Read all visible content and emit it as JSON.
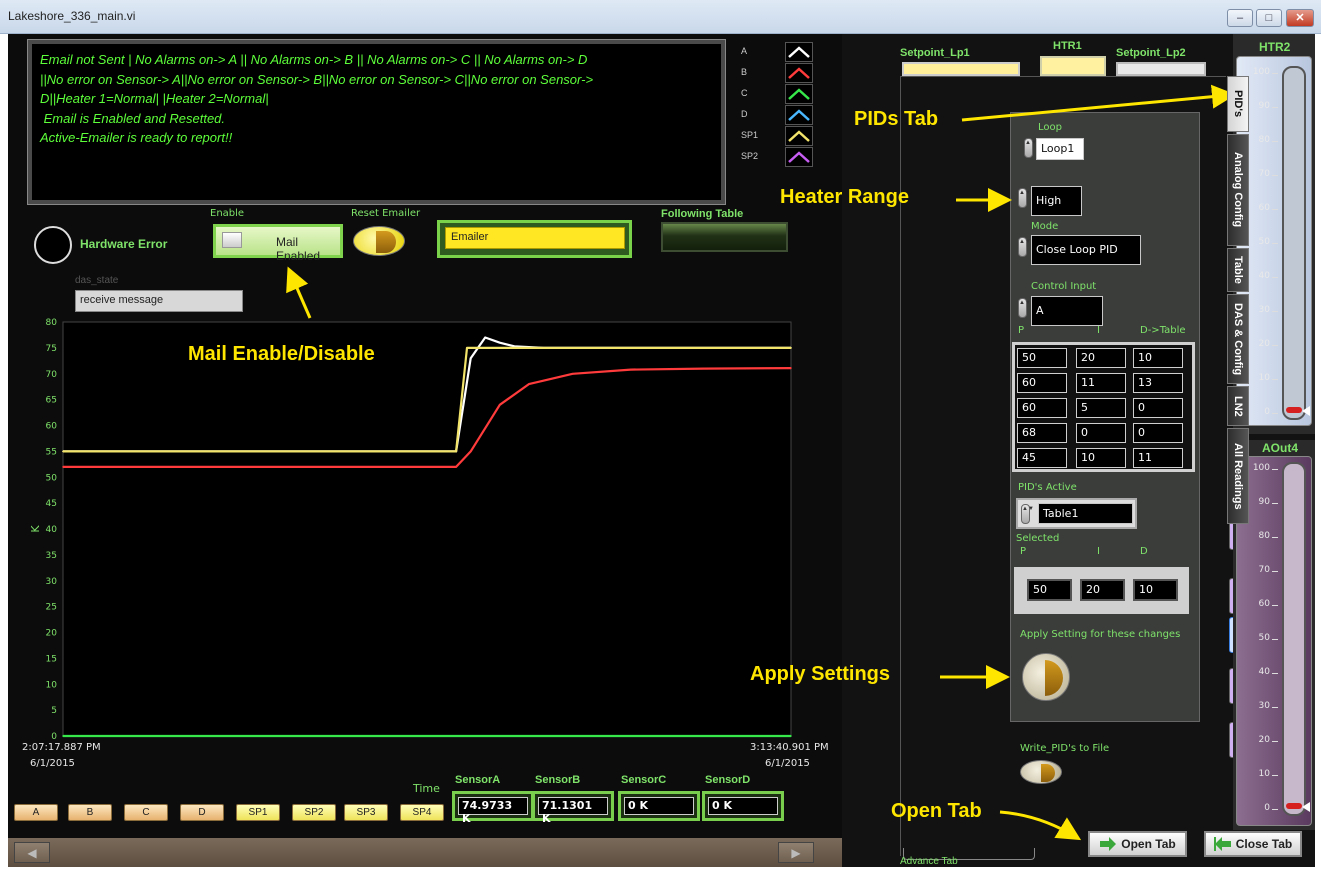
{
  "window": {
    "title": "Lakeshore_336_main.vi",
    "min": "–",
    "max": "□",
    "close": "✕"
  },
  "status_message": "Email not Sent | No Alarms on-> A || No Alarms on-> B || No Alarms on-> C || No Alarms on-> D\n||No error on Sensor-> A||No error on Sensor-> B||No error on Sensor-> C||No error on Sensor->\nD||Heater 1=Normal| |Heater 2=Normal|\n Email is Enabled and Resetted.\nActive-Emailer is ready to report!!",
  "legend": [
    {
      "label": "A",
      "color": "#ffffff"
    },
    {
      "label": "B",
      "color": "#ff3b3b"
    },
    {
      "label": "C",
      "color": "#37e84a"
    },
    {
      "label": "D",
      "color": "#4ab8ff"
    },
    {
      "label": "SP1",
      "color": "#f2e36a"
    },
    {
      "label": "SP2",
      "color": "#c75df2"
    }
  ],
  "controls": {
    "hardware_error": "Hardware Error",
    "enable_label": "Enable",
    "mail_button": "Mail Enabled",
    "reset_label": "Reset Emailer",
    "emailer_value": "Emailer",
    "following_table": "Following Table",
    "das_state_label": "das_state",
    "das_state_value": "receive message"
  },
  "annotations": {
    "mail": "Mail Enable/Disable",
    "pids_tab": "PIDs Tab",
    "heater_range": "Heater Range",
    "apply": "Apply Settings",
    "open_tab": "Open Tab"
  },
  "chart_data": {
    "type": "line",
    "ylabel": "K",
    "ylim": [
      0,
      80
    ],
    "yticks": [
      0,
      5,
      10,
      15,
      20,
      25,
      30,
      35,
      40,
      45,
      50,
      55,
      60,
      65,
      70,
      75,
      80
    ],
    "x_start_label": "2:07:17.887 PM",
    "x_start_date": "6/1/2015",
    "x_end_label": "3:13:40.901 PM",
    "x_end_date": "6/1/2015",
    "x_axis_title": "Time",
    "series": [
      {
        "name": "A",
        "color": "#ffffff",
        "x": [
          0,
          0.54,
          0.56,
          0.58,
          0.6,
          0.62,
          0.66,
          0.72,
          1
        ],
        "y": [
          55,
          55,
          73,
          77,
          76,
          75.3,
          75,
          75,
          75
        ]
      },
      {
        "name": "B",
        "color": "#ff3b3b",
        "x": [
          0,
          0.54,
          0.56,
          0.6,
          0.64,
          0.7,
          0.78,
          0.88,
          1
        ],
        "y": [
          52,
          52,
          55,
          64,
          68,
          70,
          70.8,
          71,
          71.1
        ]
      },
      {
        "name": "SP1",
        "color": "#f2e36a",
        "x": [
          0,
          0.54,
          0.555,
          1
        ],
        "y": [
          55,
          55,
          75,
          75
        ]
      },
      {
        "name": "C",
        "color": "#37e84a",
        "x": [
          0,
          1
        ],
        "y": [
          0,
          0
        ]
      }
    ]
  },
  "sensors": [
    {
      "title": "SensorA",
      "value": "74.9733 K"
    },
    {
      "title": "SensorB",
      "value": "71.1301 K"
    },
    {
      "title": "SensorC",
      "value": "0 K"
    },
    {
      "title": "SensorD",
      "value": "0 K"
    }
  ],
  "channel_buttons": [
    "A",
    "B",
    "C",
    "D",
    "SP1",
    "SP2",
    "SP3",
    "SP4"
  ],
  "top_right": {
    "setpoint_lp1": "Setpoint_Lp1",
    "htr1": "HTR1",
    "setpoint_lp2": "Setpoint_Lp2",
    "htr2": "HTR2",
    "aout4": "AOut4"
  },
  "pid_panel": {
    "loop_label": "Loop",
    "loop_value": "Loop1",
    "range_value": "High",
    "mode_label": "Mode",
    "mode_value": "Close Loop PID",
    "control_input_label": "Control Input",
    "control_input_value": "A",
    "col_p": "P",
    "col_i": "I",
    "col_d": "D->Table",
    "table": [
      [
        "50",
        "20",
        "10"
      ],
      [
        "60",
        "11",
        "13"
      ],
      [
        "60",
        "5",
        "0"
      ],
      [
        "68",
        "0",
        "0"
      ],
      [
        "45",
        "10",
        "11"
      ]
    ],
    "pids_active_label": "PID's Active",
    "pids_active_value": "Table1",
    "selected_label": "Selected",
    "sel_p": "P",
    "sel_i": "I",
    "sel_d": "D",
    "selected_values": [
      "50",
      "20",
      "10"
    ],
    "apply_label": "Apply Setting for these changes",
    "write_label": "Write_PID's to File"
  },
  "tabs": [
    "PID's",
    "Analog Config",
    "Table",
    "DAS & Config",
    "LN2",
    "All Readings"
  ],
  "scale": [
    "100",
    "90",
    "80",
    "70",
    "60",
    "50",
    "40",
    "30",
    "20",
    "10",
    "0"
  ],
  "htr2_level": 0,
  "aout4_level": 0,
  "buttons": {
    "open_tab": "Open Tab",
    "close_tab": "Close Tab",
    "advance_tab": "Advance Tab"
  }
}
